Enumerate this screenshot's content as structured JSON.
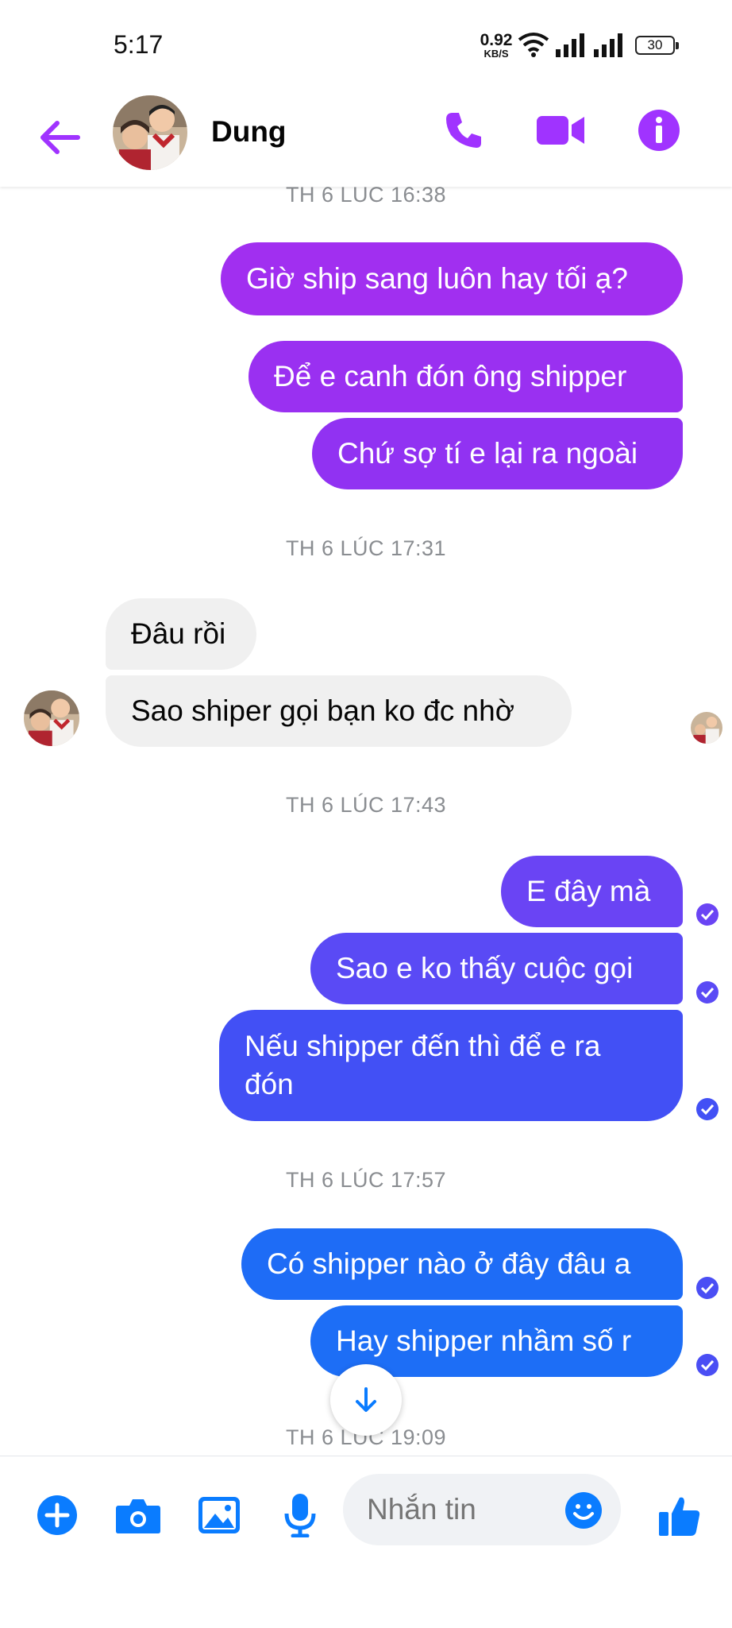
{
  "status_bar": {
    "time": "5:17",
    "net_speed_value": "0.92",
    "net_speed_unit": "KB/S",
    "battery": "30"
  },
  "header": {
    "contact_name": "Dung",
    "icons": [
      "back-arrow-icon",
      "phone-icon",
      "video-camera-icon",
      "info-icon"
    ],
    "accent_color": "#a033ff"
  },
  "conversation": {
    "groups": [
      {
        "timestamp": "TH 6 LÚC 16:38",
        "messages": [
          {
            "from": "me",
            "text": "Giờ ship sang luôn hay tối ạ?"
          },
          {
            "from": "me",
            "text": "Để e canh đón ông shipper"
          },
          {
            "from": "me",
            "text": "Chứ sợ tí e lại ra ngoài"
          }
        ]
      },
      {
        "timestamp": "TH 6 LÚC 17:31",
        "messages": [
          {
            "from": "contact",
            "text": "Đâu rồi"
          },
          {
            "from": "contact",
            "text": "Sao shiper gọi bạn ko đc nhờ"
          }
        ]
      },
      {
        "timestamp": "TH 6 LÚC 17:43",
        "messages": [
          {
            "from": "me",
            "text": "E đây mà"
          },
          {
            "from": "me",
            "text": "Sao e ko thấy cuộc gọi"
          },
          {
            "from": "me",
            "text": "Nếu shipper đến thì để e ra đón"
          }
        ]
      },
      {
        "timestamp": "TH 6 LÚC 17:57",
        "messages": [
          {
            "from": "me",
            "text": "Có shipper nào ở đây đâu a"
          },
          {
            "from": "me",
            "text": "Hay shipper nhầm số r"
          }
        ]
      },
      {
        "timestamp": "TH 6 LÚC 19:09",
        "messages": []
      }
    ],
    "bubble_colors": {
      "purple": "#a12ff0",
      "violet": "#7b3cf4",
      "indigo": "#4250f5",
      "blue": "#1d6ef6",
      "incoming": "#f0f0f0"
    }
  },
  "composer": {
    "placeholder": "Nhắn tin",
    "icons": [
      "plus-icon",
      "camera-icon",
      "image-icon",
      "microphone-icon",
      "emoji-icon",
      "thumbs-up-icon"
    ],
    "accent_color": "#0a7cff"
  }
}
